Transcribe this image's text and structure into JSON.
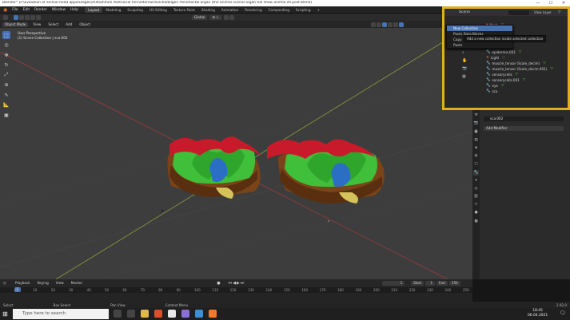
{
  "window": {
    "title": "Blender* [F:\\Evolution of animal head appendages\\Aufnahmen Postnarial Amnioten\\SOS\\schädelgen rhinohoctal organ (the animal nuchal organ full show animal.stl post.blend]",
    "minimize": "—",
    "maximize": "☐",
    "close": "✕"
  },
  "menubar": {
    "menus": [
      "File",
      "Edit",
      "Render",
      "Window",
      "Help"
    ],
    "workspace_tabs": [
      "Layout",
      "Modeling",
      "Sculpting",
      "UV Editing",
      "Texture Paint",
      "Shading",
      "Animation",
      "Rendering",
      "Compositing",
      "Scripting",
      "+"
    ],
    "active_workspace": "Layout",
    "scene_label": "Scene",
    "view_layer_label": "View Layer"
  },
  "header": {
    "mode": "Object Mode",
    "menus": [
      "View",
      "Select",
      "Add",
      "Object"
    ],
    "orientation": "Global",
    "snap_label": "⊕ ∿"
  },
  "viewport": {
    "perspective": "User Perspective",
    "collection_label": "(1) Scene Collection | sca.002"
  },
  "outliner": {
    "header_label": "Scene",
    "context_menu": [
      "New Collection",
      "Paste Data-Blocks",
      "Copy",
      "Paste"
    ],
    "tooltip": "Add a new collection inside selected collection",
    "objects": [
      "Mesh",
      "mesh.001",
      "cubie",
      "cube.002",
      "epidermis",
      "epidermis.001",
      "Light",
      "muscle_tensor (Scale_decim)",
      "muscle_tensor (Scale_decim.001)",
      "sensorycells",
      "sensorycells.001",
      "eye",
      "sca"
    ]
  },
  "properties": {
    "object_name": "sca.002",
    "add_modifier": "Add Modifier"
  },
  "timeline": {
    "menus": [
      "Playback",
      "Keying",
      "View",
      "Marker"
    ],
    "current_frame": "1",
    "start_label": "Start",
    "start_value": "1",
    "end_label": "End",
    "end_value": "250",
    "ticks": [
      "0",
      "10",
      "20",
      "30",
      "40",
      "50",
      "60",
      "70",
      "80",
      "90",
      "100",
      "110",
      "120",
      "130",
      "140",
      "150",
      "160",
      "170",
      "180",
      "190",
      "200",
      "210",
      "220",
      "230",
      "240",
      "250"
    ]
  },
  "statusbar": {
    "select": "Select",
    "box_select": "Box Select",
    "pan_view": "Pan View",
    "context_menu": "Context Menu",
    "version": "2.92.0"
  },
  "taskbar": {
    "search_placeholder": "Type here to search",
    "time": "18:45",
    "date": "06.04.2021"
  },
  "colors": {
    "accent": "#4772b3",
    "highlight_border": "#e0ae1e",
    "modifier_icon": "#ff8a2a",
    "mesh_icon": "#6cc24a",
    "model_red": "#c81a2a",
    "model_green": "#3fbf3a",
    "model_blue": "#2a6fc4",
    "model_brown": "#7a4418"
  }
}
